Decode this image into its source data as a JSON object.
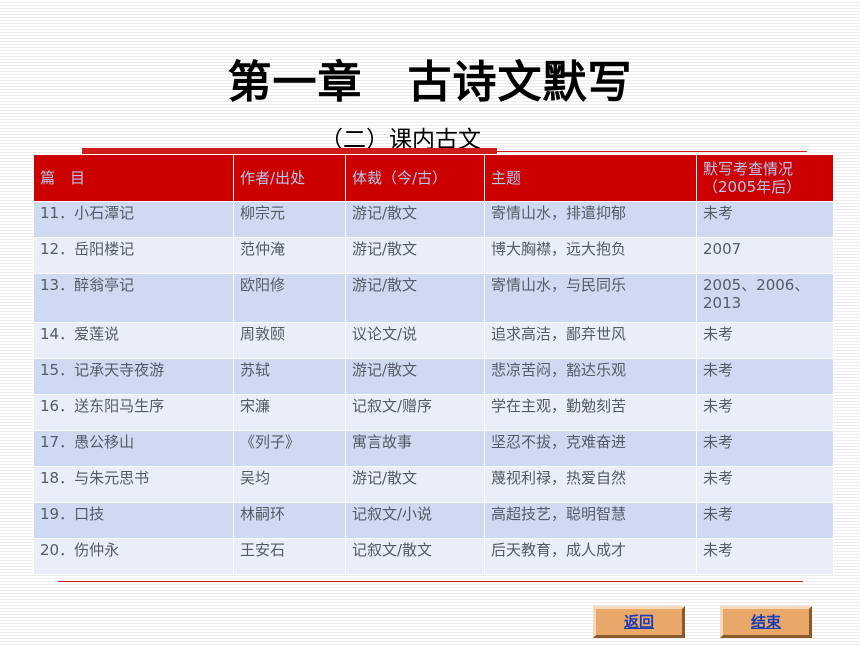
{
  "title": "第一章　古诗文默写",
  "subtitle": "（二）课内古文",
  "table": {
    "headers": [
      "篇　目",
      "作者/出处",
      "体裁（今/古）",
      "主题",
      "默写考查情况（2005年后）"
    ],
    "rows": [
      {
        "title": "11．小石潭记",
        "author": "柳宗元",
        "genre": "游记/散文",
        "theme": "寄情山水，排遣抑郁",
        "exam": "未考"
      },
      {
        "title": "12．岳阳楼记",
        "author": "范仲淹",
        "genre": "游记/散文",
        "theme": "博大胸襟，远大抱负",
        "exam": "2007"
      },
      {
        "title": "13．醉翁亭记",
        "author": "欧阳修",
        "genre": "游记/散文",
        "theme": "寄情山水，与民同乐",
        "exam": "2005、2006、2013"
      },
      {
        "title": "14．爱莲说",
        "author": "周敦颐",
        "genre": "议论文/说",
        "theme": "追求高洁，鄙弃世风",
        "exam": "未考"
      },
      {
        "title": "15．记承天寺夜游",
        "author": "苏轼",
        "genre": "游记/散文",
        "theme": "悲凉苦闷，豁达乐观",
        "exam": "未考"
      },
      {
        "title": "16．送东阳马生序",
        "author": "宋濂",
        "genre": "记叙文/赠序",
        "theme": "学在主观，勤勉刻苦",
        "exam": "未考"
      },
      {
        "title": "17．愚公移山",
        "author": "《列子》",
        "genre": "寓言故事",
        "theme": "坚忍不拔，克难奋进",
        "exam": "未考"
      },
      {
        "title": "18．与朱元思书",
        "author": "吴均",
        "genre": "游记/散文",
        "theme": "蔑视利禄，热爱自然",
        "exam": "未考"
      },
      {
        "title": "19．口技",
        "author": "林嗣环",
        "genre": "记叙文/小说",
        "theme": "高超技艺，聪明智慧",
        "exam": "未考"
      },
      {
        "title": "20．伤仲永",
        "author": "王安石",
        "genre": "记叙文/散文",
        "theme": "后天教育，成人成才",
        "exam": "未考"
      }
    ]
  },
  "buttons": {
    "back": "返回",
    "end": "结束"
  },
  "colors": {
    "header_bg": "#cc0000",
    "accent_red": "#d11a1a",
    "row_odd": "#cfd9f2",
    "row_even": "#e9eef9",
    "button_bg": "#e8a86a",
    "button_text": "#1a3cb8"
  }
}
